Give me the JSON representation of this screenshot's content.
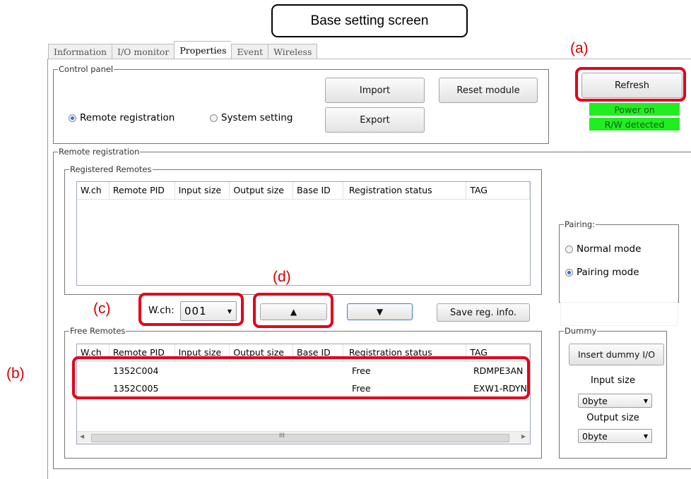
{
  "callout_title": "Base setting screen",
  "annotations": {
    "a": "(a)",
    "b": "(b)",
    "c": "(c)",
    "d": "(d)"
  },
  "tabs": [
    {
      "label": "Information",
      "active": false
    },
    {
      "label": "I/O monitor",
      "active": false
    },
    {
      "label": "Properties",
      "active": true
    },
    {
      "label": "Event",
      "active": false
    },
    {
      "label": "Wireless",
      "active": false
    }
  ],
  "control_panel": {
    "title": "Control panel",
    "radio_remote": "Remote registration",
    "radio_system": "System setting",
    "selected": "Remote registration",
    "import_label": "Import",
    "export_label": "Export",
    "reset_label": "Reset module"
  },
  "refresh_label": "Refresh",
  "status": {
    "power": "Power on",
    "rw": "R/W detected",
    "color": "#20ee20"
  },
  "remote_registration": {
    "title": "Remote registration",
    "registered": {
      "title": "Registered Remotes",
      "columns": [
        "W.ch",
        "Remote PID",
        "Input size",
        "Output size",
        "Base ID",
        "Registration status",
        "TAG"
      ]
    },
    "wch_label": "W.ch:",
    "wch_value": "001",
    "up_label": "▲",
    "down_label": "▼",
    "save_label": "Save reg. info.",
    "free": {
      "title": "Free Remotes",
      "columns": [
        "W.ch",
        "Remote PID",
        "Input size",
        "Output size",
        "Base ID",
        "Registration status",
        "TAG"
      ],
      "rows": [
        {
          "pid": "1352C004",
          "status": "Free",
          "tag": "RDMPE3AN"
        },
        {
          "pid": "1352C005",
          "status": "Free",
          "tag": "EXW1-RDYN"
        }
      ],
      "scroll_grip": "III"
    }
  },
  "pairing": {
    "title": "Pairing:",
    "normal": "Normal mode",
    "pairing": "Pairing mode",
    "selected": "Pairing mode"
  },
  "dummy": {
    "title": "Dummy",
    "insert_label": "Insert dummy I/O",
    "input_label": "Input size",
    "input_value": "0byte",
    "output_label": "Output size",
    "output_value": "0byte"
  },
  "accent_color": "#e4001b"
}
